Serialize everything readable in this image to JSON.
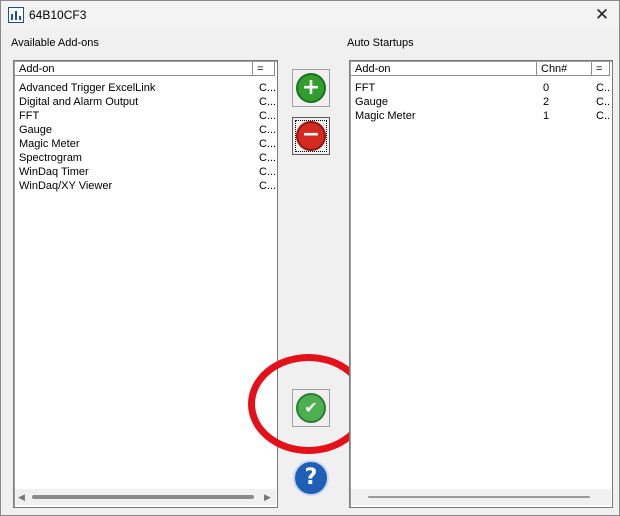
{
  "window": {
    "title": "64B10CF3",
    "close_glyph": "✕"
  },
  "available": {
    "label": "Available Add-ons",
    "headers": {
      "addon": "Add-on",
      "extra": "="
    },
    "rows": [
      {
        "name": "Advanced Trigger ExcelLink",
        "extra": "C..."
      },
      {
        "name": "Digital and Alarm Output",
        "extra": "C..."
      },
      {
        "name": "FFT",
        "extra": "C..."
      },
      {
        "name": "Gauge",
        "extra": "C..."
      },
      {
        "name": "Magic Meter",
        "extra": "C..."
      },
      {
        "name": "Spectrogram",
        "extra": "C..."
      },
      {
        "name": "WinDaq Timer",
        "extra": "C..."
      },
      {
        "name": "WinDaq/XY Viewer",
        "extra": "C..."
      }
    ]
  },
  "startups": {
    "label": "Auto Startups",
    "headers": {
      "addon": "Add-on",
      "chn": "Chn#",
      "extra": "="
    },
    "rows": [
      {
        "name": "FFT",
        "chn": "0",
        "extra": "C..."
      },
      {
        "name": "Gauge",
        "chn": "2",
        "extra": "C..."
      },
      {
        "name": "Magic Meter",
        "chn": "1",
        "extra": "C..."
      }
    ]
  },
  "buttons": {
    "add_glyph": "+",
    "remove_glyph": "−",
    "ok_glyph": "✔",
    "help_glyph": "?"
  },
  "colors": {
    "add": "#2f9e2f",
    "remove": "#d42a1f",
    "ok": "#4caf50",
    "help": "#1f5fb5",
    "highlight_ring": "#e4111a"
  },
  "icons": {
    "app": "chart-app-icon",
    "close": "close-icon",
    "add": "green-plus-icon",
    "remove": "red-minus-icon",
    "ok": "green-check-icon",
    "help": "blue-question-icon"
  }
}
